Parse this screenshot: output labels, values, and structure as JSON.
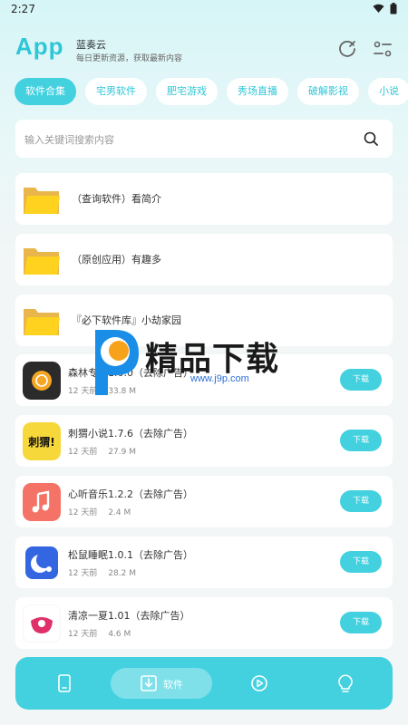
{
  "status": {
    "time": "2:27"
  },
  "header": {
    "logo": "App",
    "name": "蓝奏云",
    "subtitle": "每日更新资源，获取最新内容"
  },
  "tabs": [
    {
      "label": "软件合集",
      "active": true
    },
    {
      "label": "宅男软件"
    },
    {
      "label": "肥宅游戏"
    },
    {
      "label": "秀场直播"
    },
    {
      "label": "破解影视"
    },
    {
      "label": "小说"
    }
  ],
  "search": {
    "placeholder": "输入关键词搜索内容",
    "value": ""
  },
  "folders": [
    {
      "title": "（查询软件）看简介",
      "icon": "folder-icon"
    },
    {
      "title": "（原创应用）有趣多",
      "icon": "folder-icon"
    },
    {
      "title": "『必下软件库』小劫家园",
      "icon": "folder-icon"
    }
  ],
  "apps": [
    {
      "title": "森林专注1.0.0（去除广告）",
      "time": "12 天前",
      "size": "33.8 M",
      "button": "下载",
      "icon": "focus-timer-icon",
      "color": "#2b2b2b"
    },
    {
      "title": "刺猬小说1.7.6（去除广告）",
      "time": "12 天前",
      "size": "27.9 M",
      "button": "下载",
      "icon": "hedgehog-novel-icon",
      "color": "#f7d83a",
      "icon_text": "刺猬!"
    },
    {
      "title": "心听音乐1.2.2（去除广告）",
      "time": "12 天前",
      "size": "2.4 M",
      "button": "下载",
      "icon": "music-note-icon",
      "color": "#f47266"
    },
    {
      "title": "松鼠睡眠1.0.1（去除广告）",
      "time": "12 天前",
      "size": "28.2 M",
      "button": "下载",
      "icon": "moon-sleep-icon",
      "color": "#3366e0"
    },
    {
      "title": "清凉一夏1.01（去除广告）",
      "time": "12 天前",
      "size": "4.6 M",
      "button": "下载",
      "icon": "cool-summer-icon",
      "color": "#ffffff"
    }
  ],
  "watermark": {
    "title": "精品下载",
    "url": "www.j9p.com"
  },
  "bottom_nav": [
    {
      "icon": "phone-icon"
    },
    {
      "icon": "download-icon",
      "label": "软件",
      "active": true
    },
    {
      "icon": "play-icon"
    },
    {
      "icon": "lightbulb-icon"
    }
  ],
  "colors": {
    "accent": "#43d1e0",
    "logo": "#2fc6d6"
  }
}
